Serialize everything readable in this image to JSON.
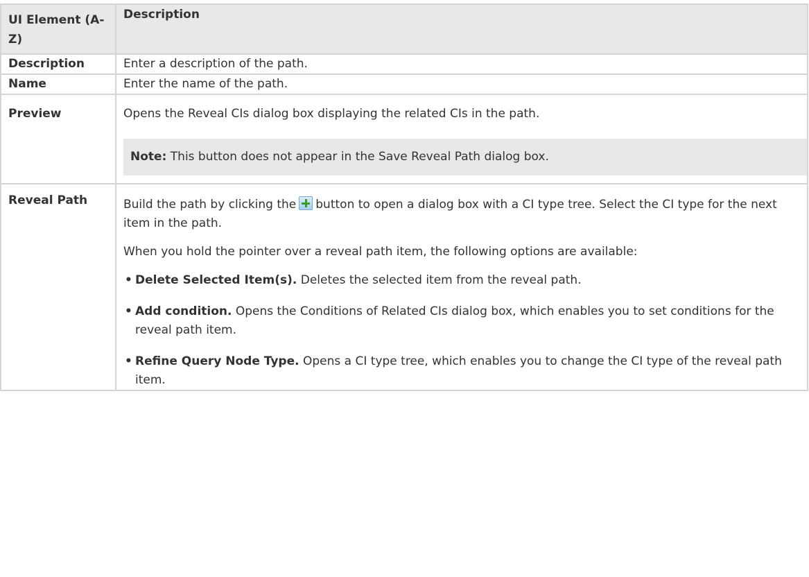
{
  "header": {
    "col1": "UI Element (A-Z)",
    "col2": "Description"
  },
  "rows": [
    {
      "element": "Description",
      "description": "Enter a description of the path."
    },
    {
      "element": "Name",
      "description": "Enter the name of the path."
    },
    {
      "element": "Preview",
      "description": "Opens the Reveal CIs dialog box displaying the related CIs in the path.",
      "note_label": "Note:",
      "note_text": " This button does not appear in the Save Reveal Path dialog box."
    },
    {
      "element": "Reveal Path",
      "desc_part1": "Build the path by clicking the",
      "desc_icon": "add-plus-icon",
      "desc_part2": "button to open a dialog box with a CI type tree. Select the CI type for the next item in the path.",
      "intro": "When you hold the pointer over a reveal path item, the following options are available:",
      "options": [
        {
          "label": "Delete Selected Item(s).",
          "text": " Deletes the selected item from the reveal path."
        },
        {
          "label": "Add condition.",
          "text": " Opens the Conditions of Related CIs dialog box, which enables you to set conditions for the reveal path item."
        },
        {
          "label": "Refine Query Node Type.",
          "text": " Opens a CI type tree, which enables you to change the CI type of the reveal path item."
        }
      ]
    }
  ],
  "colors": {
    "header_bg": "#e8e8e8",
    "border": "#d4d4d4",
    "note_bg": "#e8e8e8",
    "text": "#333333"
  }
}
